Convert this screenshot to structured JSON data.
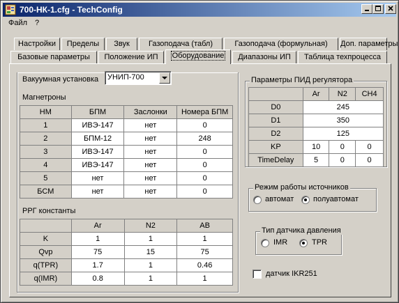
{
  "window": {
    "title": "700-НК-1.cfg - TechConfig"
  },
  "menu": [
    "Файл",
    "?"
  ],
  "tabs_row1": [
    "Настройки",
    "Пределы",
    "Звук",
    "Газоподача (табл)",
    "Газоподача (формульная)",
    "Доп. параметры"
  ],
  "tabs_row2": [
    "Базовые параметры",
    "Положение ИП",
    "Оборудование",
    "Диапазоны ИП",
    "Таблица техпроцесса"
  ],
  "active_tab": "Оборудование",
  "vacuum": {
    "label": "Вакуумная установка",
    "value": "УНИП-700"
  },
  "magnetrons": {
    "title": "Магнетроны",
    "headers": [
      "НМ",
      "БПМ",
      "Заслонки",
      "Номера БПМ"
    ],
    "rows": [
      [
        "1",
        "ИВЭ-147",
        "нет",
        "0"
      ],
      [
        "2",
        "БПМ-12",
        "нет",
        "248"
      ],
      [
        "3",
        "ИВЭ-147",
        "нет",
        "0"
      ],
      [
        "4",
        "ИВЭ-147",
        "нет",
        "0"
      ],
      [
        "5",
        "нет",
        "нет",
        "0"
      ],
      [
        "БСМ",
        "нет",
        "нет",
        "0"
      ]
    ]
  },
  "rrg": {
    "title": "РРГ константы",
    "headers": [
      "",
      "Ar",
      "N2",
      "AB"
    ],
    "rows": [
      [
        "K",
        "1",
        "1",
        "1"
      ],
      [
        "Qvp",
        "75",
        "15",
        "75"
      ],
      [
        "q(TPR)",
        "1.7",
        "1",
        "0.46"
      ],
      [
        "q(IMR)",
        "0.8",
        "1",
        "1"
      ]
    ]
  },
  "pid": {
    "title": "Параметры ПИД регулятора",
    "headers": [
      "",
      "Ar",
      "N2",
      "CH4"
    ],
    "merged_rows": [
      {
        "label": "D0",
        "value": "245"
      },
      {
        "label": "D1",
        "value": "350"
      },
      {
        "label": "D2",
        "value": "125"
      }
    ],
    "rows": [
      [
        "KP",
        "10",
        "0",
        "0"
      ],
      [
        "TimeDelay",
        "5",
        "0",
        "0"
      ]
    ]
  },
  "source_mode": {
    "title": "Режим работы источников",
    "options": [
      "автомат",
      "полуавтомат"
    ],
    "selected": "полуавтомат"
  },
  "pressure_sensor": {
    "title": "Тип датчика давления",
    "options": [
      "IMR",
      "TPR"
    ],
    "selected": "TPR"
  },
  "ikr_checkbox": {
    "label": "датчик IKR251",
    "checked": false
  }
}
